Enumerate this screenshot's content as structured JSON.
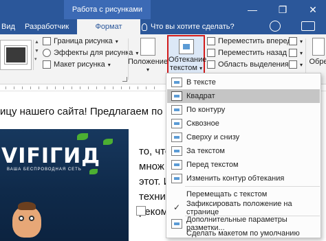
{
  "titlebar": {
    "context_group": "Работа с рисунками",
    "minimize": "—",
    "restore": "❐",
    "close": "✕"
  },
  "tabs": {
    "items": [
      {
        "label": "Вид"
      },
      {
        "label": "Разработчик"
      },
      {
        "label": "Формат"
      }
    ],
    "tell_me": "Что вы хотите сделать?"
  },
  "ribbon": {
    "border": "Граница рисунка",
    "effects": "Эффекты для рисунка",
    "layout": "Макет рисунка",
    "position": "Положение",
    "wrap_line1": "Обтекание",
    "wrap_line2": "текстом",
    "bring_forward": "Переместить вперед",
    "send_backward": "Переместить назад",
    "selection_pane": "Область выделения",
    "crop_partial": "Обре"
  },
  "document": {
    "line1": "ицу нашего сайта! Предлагаем по",
    "side1": "то, что",
    "side2": "множ",
    "side3": "этот. И",
    "side4": "техни",
    "side5": "реком",
    "logo_main": "VIFIГИД",
    "logo_sub": "ВАША БЕСПРОВОДНАЯ СЕТЬ"
  },
  "wrap_menu": {
    "items": [
      {
        "label": "В тексте",
        "icon": "inline-wrap-icon"
      },
      {
        "label": "Квадрат",
        "icon": "square-wrap-icon"
      },
      {
        "label": "По контуру",
        "icon": "tight-wrap-icon"
      },
      {
        "label": "Сквозное",
        "icon": "through-wrap-icon"
      },
      {
        "label": "Сверху и снизу",
        "icon": "top-bottom-wrap-icon"
      },
      {
        "label": "За текстом",
        "icon": "behind-text-icon"
      },
      {
        "label": "Перед текстом",
        "icon": "in-front-text-icon"
      },
      {
        "label": "Изменить контур обтекания",
        "icon": "edit-wrap-points-icon"
      },
      {
        "label": "Перемещать с текстом"
      },
      {
        "label": "Зафиксировать положение на странице",
        "checked": true
      },
      {
        "label": "Дополнительные параметры разметки...",
        "icon": "more-layout-icon"
      },
      {
        "label": "Сделать макетом по умолчанию"
      }
    ],
    "highlighted_index": 1
  },
  "colors": {
    "title_bar": "#2b579a",
    "highlight": "#c5c5c5",
    "wrap_button_outline": "#d11a1a"
  }
}
